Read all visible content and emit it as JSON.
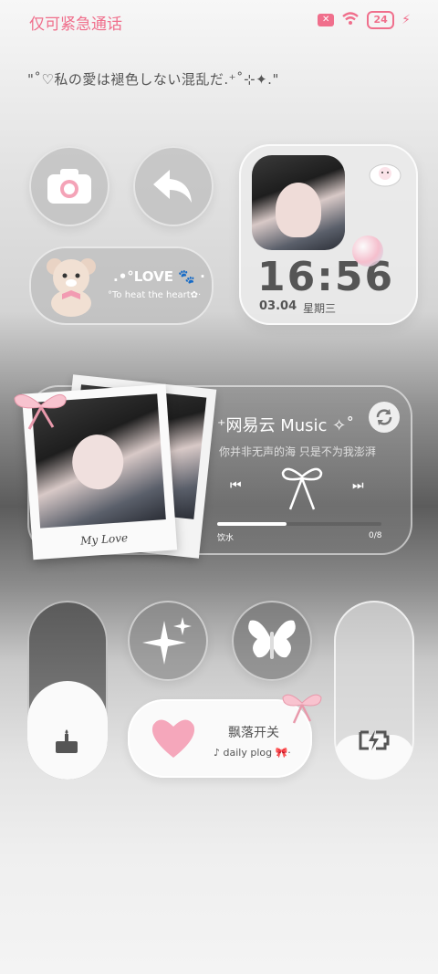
{
  "status_bar": {
    "carrier": "仅可紧急通话",
    "battery": "24",
    "icons": [
      "sim-icon",
      "wifi-icon",
      "battery-icon",
      "charging-icon"
    ]
  },
  "quote": "\"˚♡私の愛は褪色しない混乱だ.⁺˚⊹✦.\"",
  "widgets": {
    "camera": {
      "icon": "camera-icon"
    },
    "back": {
      "icon": "back-arrow-icon"
    },
    "love": {
      "title": ".•°LOVE 🐾 ·",
      "subtitle": "°To heat the heart✿·",
      "icon": "teddy-bear-icon"
    },
    "clock": {
      "time": "16:56",
      "date": "03.04",
      "weekday": "星期三",
      "icon": "bunny-cloud-icon"
    }
  },
  "music": {
    "app": "⁺网易云 Music ✧˚",
    "lyric": "你并非无声的海 只是不为我澎湃",
    "photo_caption": "My Love",
    "track_left": "饮水",
    "track_right": "0/8",
    "progress": 0.42,
    "icons": {
      "prev": "previous-icon",
      "next": "next-icon",
      "center": "ribbon-bow-icon",
      "refresh": "refresh-icon"
    }
  },
  "bottom": {
    "slider_left": {
      "icon": "cake-icon",
      "level": 0.55
    },
    "sparkle": {
      "icon": "sparkle-icon"
    },
    "butterfly": {
      "icon": "butterfly-icon"
    },
    "card": {
      "title": "飘落开关",
      "subtitle": "♪ daily plog 🎀·",
      "icon": "pink-heart-icon"
    },
    "slider_right": {
      "icon": "battery-charging-icon",
      "level": 0.25
    }
  },
  "colors": {
    "accent": "#f06f8c",
    "pink": "#f4a3b7"
  }
}
